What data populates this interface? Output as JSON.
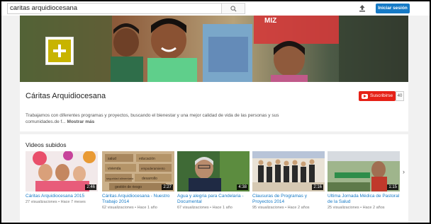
{
  "search": {
    "value": "caritas arquidiocesana"
  },
  "header": {
    "signin_label": "Iniciar sesión"
  },
  "banner": {
    "text": "MIZ"
  },
  "channel": {
    "title": "Cáritas Arquidiocesana",
    "subscribe_label": "Suscribirse",
    "subscriber_count": "40",
    "description": "Trabajamos con diferentes programas y proyectos, buscando el bienestar y una mejor calidad de vida de las personas y sus comunidades.de f...",
    "more_label": "Mostrar más"
  },
  "videos": {
    "heading": "Videos subidos",
    "items": [
      {
        "title": "Cáritas Arquidiocesana 2015",
        "meta": "27 visualizaciones • Hace 7 meses",
        "duration": "2:46"
      },
      {
        "title": "Cáritas Arquidiocesana - Nuestro Trabajo 2014",
        "meta": "62 visualizaciones • Hace 1 año",
        "duration": "2:27"
      },
      {
        "title": "Agua y alegria para Candelaria - Documental",
        "meta": "67 visualizaciones • Hace 1 año",
        "duration": "4:38"
      },
      {
        "title": "Clausuras de Programas y Proyectos 2014",
        "meta": "95 visualizaciones • Hace 2 años",
        "duration": "2:16"
      },
      {
        "title": "Ultima Jornada Médica de Pastoral de la Salud",
        "meta": "25 visualizaciones • Hace 2 años",
        "duration": "1:15"
      }
    ],
    "thumb2_words": [
      "salud",
      "educación",
      "vivienda",
      "empoderamiento",
      "seguridad alimentaria",
      "desarrollo",
      "gestión de riesgo"
    ]
  },
  "colors": {
    "subscribe": "#e62117",
    "link": "#167ac6",
    "signin": "#167ac6",
    "logo": "#c8b400"
  }
}
